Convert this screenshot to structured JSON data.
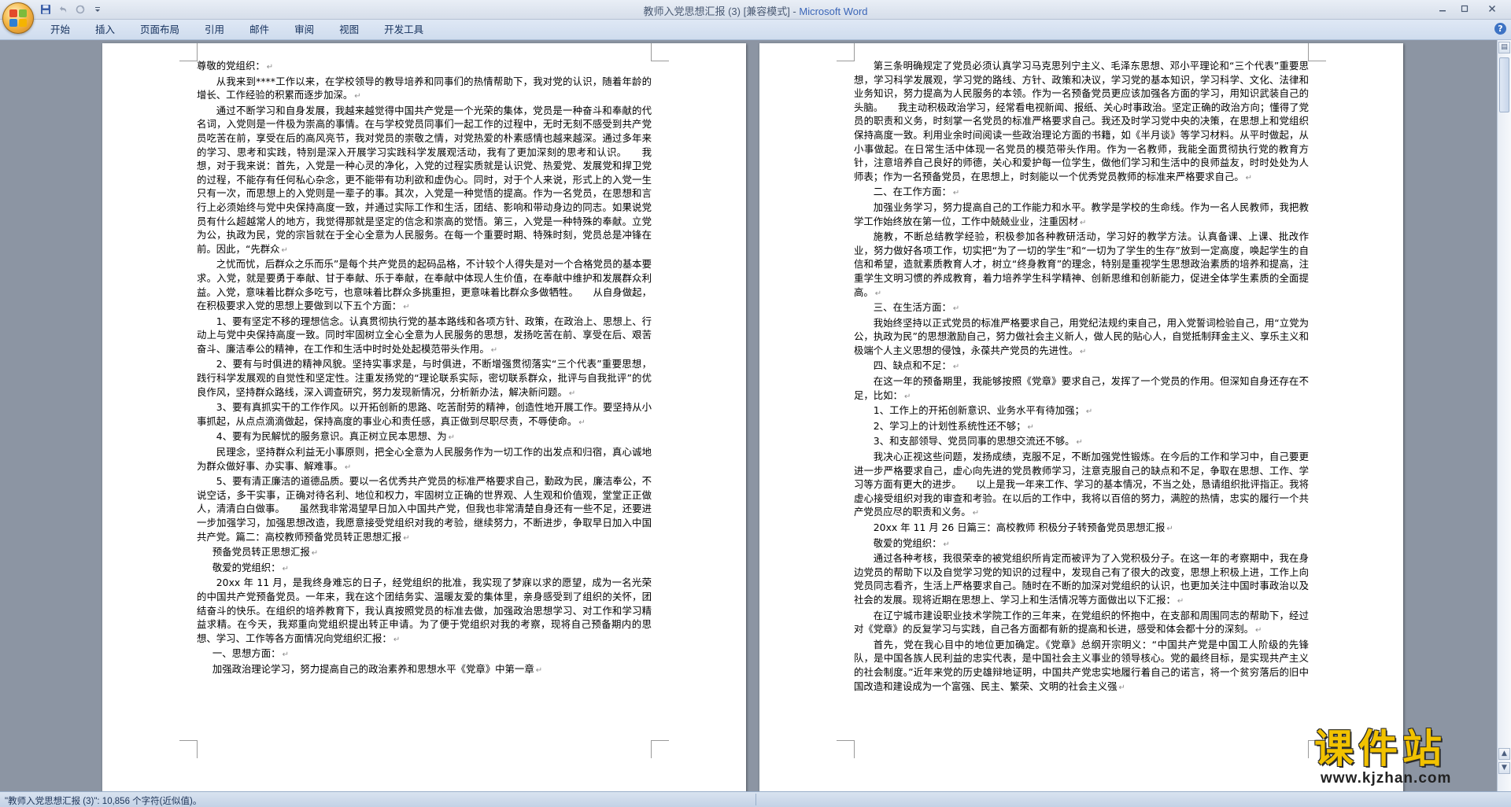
{
  "window": {
    "doc_title": "教师入党思想汇报 (3) [兼容模式] - ",
    "app_name": "Microsoft Word"
  },
  "ribbon": {
    "tabs": [
      "开始",
      "插入",
      "页面布局",
      "引用",
      "邮件",
      "审阅",
      "视图",
      "开发工具"
    ]
  },
  "qat": {
    "icons": [
      "save-icon",
      "undo-icon",
      "redo-icon",
      "customize-icon"
    ]
  },
  "office_logo_colors": [
    "#e24a2a",
    "#7dbb3c",
    "#2f7fd1",
    "#f5b400"
  ],
  "status": {
    "text": "\"教师入党思想汇报 (3)\": 10,856 个字符(近似值)。"
  },
  "watermark": {
    "chinese": "课件站",
    "url": "www.kjzhan.com"
  },
  "page_left": {
    "paragraphs": [
      {
        "text": "尊敬的党组织：",
        "style": "noind"
      },
      {
        "text": "从我来到****工作以来，在学校领导的教导培养和同事们的热情帮助下，我对党的认识，随着年龄的增长、工作经验的积累而逐步加深。",
        "style": ""
      },
      {
        "text": "通过不断学习和自身发展，我越来越觉得中国共产党是一个光荣的集体，党员是一种奋斗和奉献的代名词，入党则是一件极为崇高的事情。在与学校党员同事们一起工作的过程中，无时无刻不感受到共产党员吃苦在前，享受在后的高风亮节，我对党员的崇敬之情，对党热爱的朴素感情也越来越深。通过多年来的学习、思考和实践，特别是深入开展学习实践科学发展观活动，我有了更加深刻的思考和认识。　　我想，对于我来说：首先，入党是一种心灵的净化，入党的过程实质就是认识党、热爱党、发展党和捍卫党的过程，不能存有任何私心杂念，更不能带有功利欲和虚伪心。同时，对于个人来说，形式上的入党一生只有一次，而思想上的入党则是一辈子的事。其次，入党是一种觉悟的提高。作为一名党员，在思想和言行上必须始终与党中央保持高度一致，并通过实际工作和生活，团结、影响和带动身边的同志。如果说党员有什么超越常人的地方，我觉得那就是坚定的信念和崇高的觉悟。第三，入党是一种特殊的奉献。立党为公，执政为民，党的宗旨就在于全心全意为人民服务。在每一个重要时期、特殊时刻，党员总是冲锋在前。因此，“先群众",
        "style": ""
      },
      {
        "text": "之忧而忧，后群众之乐而乐”是每个共产党员的起码品格，不计较个人得失是对一个合格党员的基本要求。入党，就是要勇于奉献、甘于奉献、乐于奉献，在奉献中体现人生价值，在奉献中维护和发展群众利益。入党，意味着比群众多吃亏，也意味着比群众多挑重担，更意味着比群众多做牺牲。　　从自身做起，在积极要求入党的思想上要做到以下五个方面：",
        "style": ""
      },
      {
        "text": "1、要有坚定不移的理想信念。认真贯彻执行党的基本路线和各项方针、政策，在政治上、思想上、行动上与党中央保持高度一致。同时牢固树立全心全意为人民服务的思想，发扬吃苦在前、享受在后、艰苦奋斗、廉洁奉公的精神，在工作和生活中时时处处起模范带头作用。",
        "style": ""
      },
      {
        "text": "2、要有与时俱进的精神风貌。坚持实事求是，与时俱进，不断增强贯彻落实“三个代表”重要思想，践行科学发展观的自觉性和坚定性。注重发扬党的“理论联系实际，密切联系群众，批评与自我批评”的优良作风，坚持群众路线，深入调查研究，努力发现新情况，分析新办法，解决新问题。",
        "style": ""
      },
      {
        "text": "3、要有真抓实干的工作作风。以开拓创新的思路、吃苦耐劳的精神，创造性地开展工作。要坚持从小事抓起，从点点滴滴做起，保持高度的事业心和责任感，真正做到尽职尽责，不辱使命。",
        "style": ""
      },
      {
        "text": "4、要有为民解忧的服务意识。真正树立民本思想、为",
        "style": ""
      },
      {
        "text": "民理念，坚持群众利益无小事原则，把全心全意为人民服务作为一切工作的出发点和归宿，真心诚地为群众做好事、办实事、解难事。",
        "style": ""
      },
      {
        "text": "5、要有清正廉洁的道德品质。要以一名优秀共产党员的标准严格要求自己，勤政为民，廉洁奉公，不说空话，多干实事，正确对待名利、地位和权力，牢固树立正确的世界观、人生观和价值观，堂堂正正做人，清清白白做事。　　虽然我非常渴望早日加入中国共产党，但我也非常清楚自身还有一些不足，还要进一步加强学习，加强思想改造，我愿意接受党组织对我的考验，继续努力，不断进步，争取早日加入中国共产党。篇二：高校教师预备党员转正思想汇报",
        "style": ""
      },
      {
        "text": "预备党员转正思想汇报",
        "style": "ind1"
      },
      {
        "text": "敬爱的党组织：",
        "style": "ind1"
      },
      {
        "text": "20xx 年 11 月，是我终身难忘的日子，经党组织的批准，我实现了梦寐以求的愿望，成为一名光荣的中国共产党预备党员。一年来，我在这个团结务实、温暖友爱的集体里，亲身感受到了组织的关怀，团结奋斗的快乐。在组织的培养教育下，我认真按照党员的标准去做，加强政治思想学习、对工作和学习精益求精。在今天，我郑重向党组织提出转正申请。为了便于党组织对我的考察，现将自己预备期内的思想、学习、工作等各方面情况向党组织汇报：",
        "style": ""
      },
      {
        "text": "一、思想方面：",
        "style": "ind1"
      },
      {
        "text": "加强政治理论学习，努力提高自己的政治素养和思想水平《党章》中第一章",
        "style": "ind1"
      }
    ]
  },
  "page_right": {
    "paragraphs": [
      {
        "text": "第三条明确规定了党员必须认真学习马克思列宁主义、毛泽东思想、邓小平理论和“三个代表”重要思想，学习科学发展观，学习党的路线、方针、政策和决议，学习党的基本知识，学习科学、文化、法律和业务知识，努力提高为人民服务的本领。作为一名预备党员更应该加强各方面的学习，用知识武装自己的头脑。　　我主动积极政治学习，经常看电视新闻、报纸、关心时事政治。坚定正确的政治方向；懂得了党员的职责和义务，时刻掌一名党员的标准严格要求自己。我还及时学习党中央的决策，在思想上和党组织保持高度一致。利用业余时间阅读一些政治理论方面的书籍，如《半月谈》等学习材料。从平时做起，从小事做起。在日常生活中体现一名党员的模范带头作用。作为一名教师，我能全面贯彻执行党的教育方针，注意培养自己良好的师德，关心和爱护每一位学生，做他们学习和生活中的良师益友，时时处处为人师表；作为一名预备党员，在思想上，时刻能以一个优秀党员教师的标准来严格要求自己。",
        "style": ""
      },
      {
        "text": "二、在工作方面：",
        "style": ""
      },
      {
        "text": "加强业务学习，努力提高自己的工作能力和水平。教学是学校的生命线。作为一名人民教师，我把教学工作始终放在第一位，工作中兢兢业业，注重因材",
        "style": ""
      },
      {
        "text": "施教，不断总结教学经验，积极参加各种教研活动，学习好的教学方法。认真备课、上课、批改作业，努力做好各项工作，切实把“为了一切的学生”和“一切为了学生的生存”放到一定高度，唤起学生的自信和希望，造就素质教育人才，树立“终身教育”的理念，特别是重视学生思想政治素质的培养和提高，注重学生文明习惯的养成教育，着力培养学生科学精神、创新思维和创新能力，促进全体学生素质的全面提高。",
        "style": ""
      },
      {
        "text": "三、在生活方面：",
        "style": ""
      },
      {
        "text": "我始终坚持以正式党员的标准严格要求自己，用党纪法规约束自己，用入党誓词检验自己，用“立党为公，执政为民”的思想激励自己，努力做社会主义新人，做人民的贴心人，自觉抵制拜金主义、享乐主义和极端个人主义思想的侵蚀，永葆共产党员的先进性。",
        "style": ""
      },
      {
        "text": "四、缺点和不足：",
        "style": ""
      },
      {
        "text": "在这一年的预备期里，我能够按照《党章》要求自己，发挥了一个党员的作用。但深知自身还存在不足，比如：",
        "style": ""
      },
      {
        "text": "1、工作上的开拓创新意识、业务水平有待加强；",
        "style": ""
      },
      {
        "text": "2、学习上的计划性系统性还不够；",
        "style": ""
      },
      {
        "text": "3、和支部领导、党员同事的思想交流还不够。",
        "style": ""
      },
      {
        "text": "我决心正视这些问题，发扬成绩，克服不足，不断加强党性锻炼。在今后的工作和学习中，自己要更进一步严格要求自己，虚心向先进的党员教师学习，注意克服自己的缺点和不足，争取在思想、工作、学习等方面有更大的进步。　　以上是我一年来工作、学习的基本情况，不当之处，恳请组织批评指正。我将虚心接受组织对我的审查和考验。在以后的工作中，我将以百倍的努力，满腔的热情，忠实的履行一个共产党员应尽的职责和义务。",
        "style": ""
      },
      {
        "text": "20xx 年 11 月 26 日篇三：高校教师 积极分子转预备党员思想汇报",
        "style": ""
      },
      {
        "text": "敬爱的党组织：",
        "style": ""
      },
      {
        "text": "通过各种考核，我很荣幸的被党组织所肯定而被评为了入党积极分子。在这一年的考察期中，我在身边党员的帮助下以及自觉学习党的知识的过程中，发现自己有了很大的改变，思想上积极上进，工作上向党员同志看齐，生活上严格要求自己。随时在不断的加深对党组织的认识，也更加关注中国时事政治以及社会的发展。现将近期在思想上、学习上和生活情况等方面做出以下汇报：",
        "style": ""
      },
      {
        "text": "在辽宁城市建设职业技术学院工作的三年来，在党组织的怀抱中，在支部和周围同志的帮助下，经过对《党章》的反复学习与实践，自己各方面都有新的提高和长进，感受和体会都十分的深刻。",
        "style": ""
      },
      {
        "text": "首先，党在我心目中的地位更加确定。《党章》总纲开宗明义：“中国共产党是中国工人阶级的先锋队，是中国各族人民利益的忠实代表，是中国社会主义事业的领导核心。党的最终目标，是实现共产主义的社会制度。”近年来党的历史雄辩地证明，中国共产党忠实地履行着自己的诺言，将一个贫穷落后的旧中国改造和建设成为一个富强、民主、繁荣、文明的社会主义强",
        "style": ""
      }
    ]
  }
}
